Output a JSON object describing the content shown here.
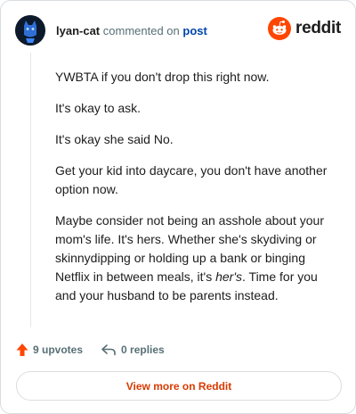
{
  "header": {
    "author": "lyan-cat",
    "action_text": "commented on",
    "post_label": "post",
    "avatar_icon": "cat-avatar",
    "logo_icon": "reddit-snoo-icon",
    "logo_text": "reddit"
  },
  "comment": {
    "paragraphs": [
      "YWBTA if you don't drop this right now.",
      "It's okay to ask.",
      "It's okay she said No.",
      "Get your kid into daycare, you don't have another option now."
    ],
    "last_paragraph": {
      "before": "Maybe consider not being an asshole about your mom's life. It's hers. Whether she's skydiving or skinnydipping or holding up a bank or binging Netflix in between meals, it's ",
      "emphasis": "her's",
      "after": ". Time for you and your husband to be parents instead."
    }
  },
  "actions": {
    "upvotes": "9 upvotes",
    "replies": "0 replies",
    "upvote_icon": "upvote-arrow-icon",
    "reply_icon": "reply-arrow-icon"
  },
  "footer": {
    "button_label": "View more on Reddit"
  },
  "colors": {
    "accent": "#d93a00",
    "link": "#0045ac",
    "upvote": "#ff4500"
  }
}
